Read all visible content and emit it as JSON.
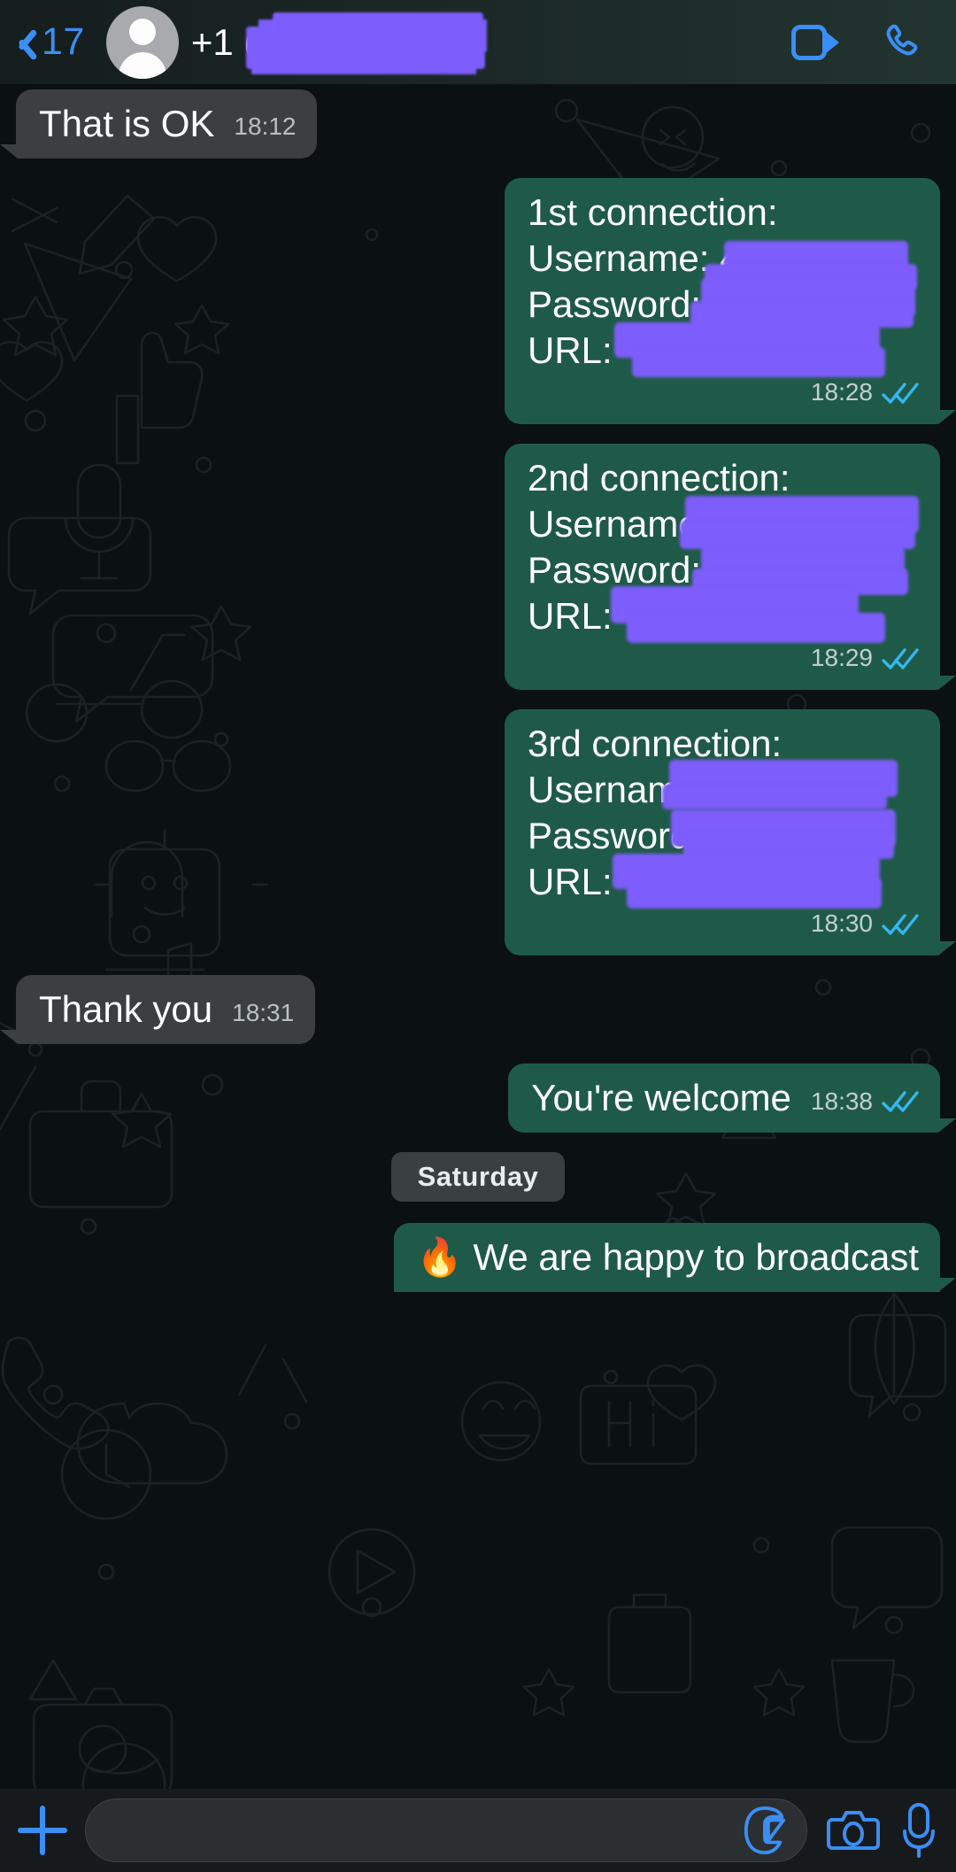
{
  "header": {
    "back_count": "17",
    "back_icon": "chevron-left-icon",
    "avatar_icon": "default-contact-avatar-icon",
    "contact_name": "+1 (",
    "contact_name_redacted": true,
    "video_call_icon": "video-camera-icon",
    "voice_call_icon": "phone-icon",
    "accent_blue": "#3b8ef5",
    "bar_bg": "#1b2725"
  },
  "theme": {
    "chat_bg": "#0b1013",
    "incoming_bubble": "#3b3f41",
    "outgoing_bubble": "#1f5a48",
    "redaction_purple": "#7d5dfb",
    "text_primary": "#ffffff",
    "meta_text": "#b9c0c3",
    "tick_blue": "#34b7f1"
  },
  "messages": [
    {
      "id": "msg-that-is-ok",
      "direction": "in",
      "kind": "single",
      "text": "That is OK",
      "time": "18:12",
      "status": null
    },
    {
      "id": "msg-1st-connection",
      "direction": "out",
      "kind": "credentials",
      "title": "1st connection:",
      "fields": [
        {
          "label": "Username:",
          "value_visible": "4",
          "redacted": true
        },
        {
          "label": "Password:",
          "value_visible": "",
          "redacted": true
        },
        {
          "label": "URL:",
          "value_visible": "",
          "redacted": true
        }
      ],
      "time": "18:28",
      "status": "read"
    },
    {
      "id": "msg-2nd-connection",
      "direction": "out",
      "kind": "credentials",
      "title": "2nd connection:",
      "fields": [
        {
          "label": "Username:",
          "value_visible": "",
          "redacted": true
        },
        {
          "label": "Password:",
          "value_visible": "",
          "redacted": true
        },
        {
          "label": "URL:",
          "value_visible": "",
          "redacted": true
        }
      ],
      "time": "18:29",
      "status": "read"
    },
    {
      "id": "msg-3rd-connection",
      "direction": "out",
      "kind": "credentials",
      "title": "3rd connection:",
      "fields": [
        {
          "label": "Username:",
          "value_visible": "",
          "redacted": true
        },
        {
          "label": "Password:",
          "value_visible": "",
          "redacted": true
        },
        {
          "label": "URL:",
          "value_visible": "",
          "redacted": true
        }
      ],
      "time": "18:30",
      "status": "read"
    },
    {
      "id": "msg-thank-you",
      "direction": "in",
      "kind": "single",
      "text": "Thank you",
      "time": "18:31",
      "status": null
    },
    {
      "id": "msg-youre-welcome",
      "direction": "out",
      "kind": "single",
      "text": "You're welcome",
      "time": "18:38",
      "status": "read"
    }
  ],
  "date_divider": {
    "label": "Saturday"
  },
  "last_message": {
    "id": "msg-broadcast",
    "direction": "out",
    "text": "🔥 We are happy to broadcast",
    "truncated": true
  },
  "composer": {
    "plus_icon": "plus-icon",
    "input_value": "",
    "input_placeholder": "",
    "sticker_icon": "sticker-icon",
    "camera_icon": "camera-icon",
    "mic_icon": "microphone-icon"
  }
}
